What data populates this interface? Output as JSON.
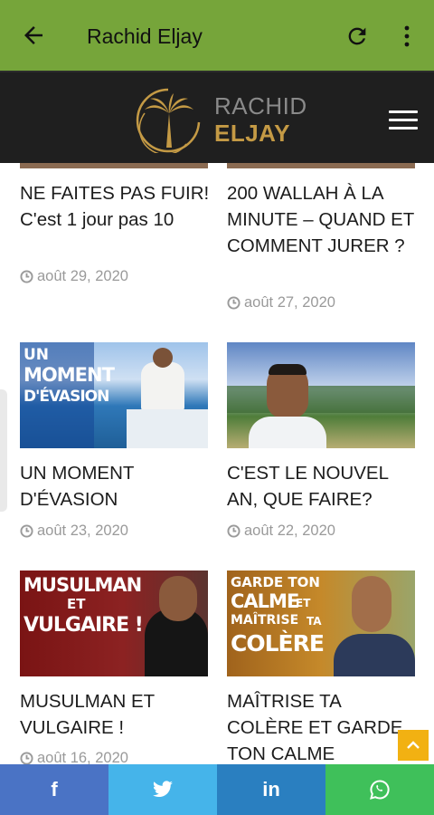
{
  "appbar": {
    "title": "Rachid Eljay",
    "back_icon": "arrow-left-icon",
    "refresh_icon": "refresh-icon",
    "more_icon": "more-vertical-icon",
    "color": "#76a53a"
  },
  "site_header": {
    "logo_line1": "RACHID",
    "logo_line2": "ELJAY",
    "menu_icon": "hamburger-icon",
    "background": "#1f1f1f",
    "logo_gold": "#c49a45"
  },
  "posts": [
    {
      "title": "NE FAITES PAS FUIR! C'est 1 jour pas 10",
      "date": "août 29, 2020"
    },
    {
      "title": "200 WALLAH À LA MINUTE – QUAND ET COMMENT JURER ?",
      "date": "août 27, 2020"
    },
    {
      "title": "UN MOMENT D'ÉVASION",
      "date": "août 23, 2020",
      "thumb_text": [
        "UN",
        "MOMENT",
        "D'ÉVASION"
      ]
    },
    {
      "title": "C'EST LE NOUVEL AN, QUE FAIRE?",
      "date": "août 22, 2020"
    },
    {
      "title": "MUSULMAN ET VULGAIRE !",
      "date": "août 16, 2020",
      "thumb_text": [
        "MUSULMAN",
        "ET",
        "VULGAIRE !"
      ]
    },
    {
      "title": "MAÎTRISE TA COLÈRE ET GARDE TON CALME",
      "date": "",
      "thumb_text": [
        "GARDE TON",
        "CALME",
        "ET",
        "MAÎTRISE",
        "TA",
        "COLÈRE"
      ]
    }
  ],
  "share_bar": [
    {
      "label": "f",
      "icon": "facebook-icon",
      "color": "#4a73c5"
    },
    {
      "label": "twitter",
      "icon": "twitter-icon",
      "color": "#45b4ea"
    },
    {
      "label": "in",
      "icon": "linkedin-icon",
      "color": "#2a7fc0"
    },
    {
      "label": "whatsapp",
      "icon": "whatsapp-icon",
      "color": "#3fc05a"
    }
  ],
  "scroll_top_icon": "chevron-up-icon",
  "scroll_top_color": "#f2b112"
}
